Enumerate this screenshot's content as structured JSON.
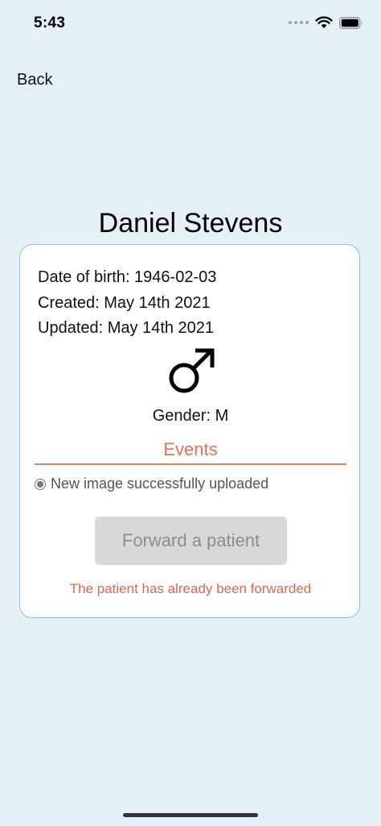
{
  "status_bar": {
    "time": "5:43"
  },
  "nav": {
    "back_label": "Back"
  },
  "patient": {
    "name": "Daniel Stevens",
    "date_of_birth": "Date of birth: 1946-02-03",
    "created": "Created: May 14th 2021",
    "updated": "Updated: May 14th 2021",
    "gender_icon": "male-symbol-icon",
    "gender": "Gender: M"
  },
  "events": {
    "tab_label": "Events",
    "items": [
      {
        "label": "New image successfully uploaded"
      }
    ]
  },
  "forward": {
    "button_label": "Forward a patient",
    "note": "The patient has already been forwarded"
  },
  "colors": {
    "background": "#e4eff6",
    "card_border": "#86c4e6",
    "accent": "#e8704f",
    "button_disabled_bg": "#d8d8d8",
    "button_disabled_text": "#8c8c8c"
  }
}
